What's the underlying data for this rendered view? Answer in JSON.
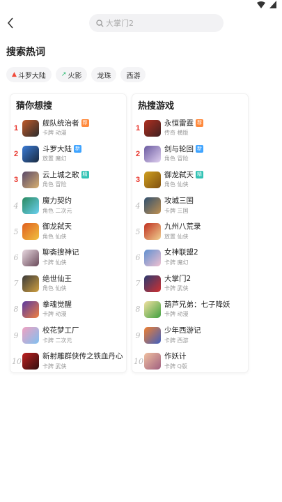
{
  "search": {
    "placeholder": "大掌门2"
  },
  "hot_words": {
    "title": "搜索热词",
    "tags": [
      {
        "label": "斗罗大陆",
        "icon": "fire-icon",
        "icon_color": "#f04a3a"
      },
      {
        "label": "火影",
        "icon": "trend-up-icon",
        "icon_color": "#1fb86a"
      },
      {
        "label": "龙珠",
        "icon": "",
        "icon_color": ""
      },
      {
        "label": "西游",
        "icon": "",
        "icon_color": ""
      }
    ]
  },
  "guess": {
    "title": "猜你想搜",
    "items": [
      {
        "rank": "1",
        "name": "舰队统治者",
        "sub": "卡牌 动漫",
        "badge": "荐",
        "badge_color": "#ff8a3d",
        "thumb": [
          "#c05a2a",
          "#2c2c2c"
        ]
      },
      {
        "rank": "2",
        "name": "斗罗大陆",
        "sub": "放置 魔幻",
        "badge": "新",
        "badge_color": "#3fa4ff",
        "thumb": [
          "#3a7bd5",
          "#1a2a40"
        ]
      },
      {
        "rank": "3",
        "name": "云上城之歌",
        "sub": "角色 冒险",
        "badge": "精",
        "badge_color": "#33c3b5",
        "thumb": [
          "#5a4a6a",
          "#d8b070"
        ]
      },
      {
        "rank": "4",
        "name": "魔力契约",
        "sub": "角色 二次元",
        "badge": "",
        "badge_color": "",
        "thumb": [
          "#2a8a60",
          "#6ad0f0"
        ]
      },
      {
        "rank": "5",
        "name": "御龙弑天",
        "sub": "角色 仙侠",
        "badge": "",
        "badge_color": "",
        "thumb": [
          "#e06020",
          "#f0c040"
        ]
      },
      {
        "rank": "6",
        "name": "聊斋搜神记",
        "sub": "卡牌 仙侠",
        "badge": "",
        "badge_color": "",
        "thumb": [
          "#e8d8e0",
          "#6a4a5a"
        ]
      },
      {
        "rank": "7",
        "name": "绝世仙王",
        "sub": "角色 仙侠",
        "badge": "",
        "badge_color": "",
        "thumb": [
          "#3a3a3a",
          "#d0a040"
        ]
      },
      {
        "rank": "8",
        "name": "拳魂觉醒",
        "sub": "卡牌 动漫",
        "badge": "",
        "badge_color": "",
        "thumb": [
          "#5a3aa0",
          "#f08040"
        ]
      },
      {
        "rank": "9",
        "name": "校花梦工厂",
        "sub": "卡牌 二次元",
        "badge": "",
        "badge_color": "",
        "thumb": [
          "#f0a0c0",
          "#80c0f0"
        ]
      },
      {
        "rank": "10",
        "name": "新射雕群侠传之铁血丹心",
        "sub": "卡牌 武侠",
        "badge": "",
        "badge_color": "",
        "thumb": [
          "#c02020",
          "#301010"
        ]
      }
    ]
  },
  "hot_games": {
    "title": "热搜游戏",
    "items": [
      {
        "rank": "1",
        "name": "永恒雷霆",
        "sub": "传奇 横版",
        "badge": "荐",
        "badge_color": "#ff8a3d",
        "thumb": [
          "#b03020",
          "#402020"
        ]
      },
      {
        "rank": "2",
        "name": "剑与轮回",
        "sub": "角色 冒险",
        "badge": "新",
        "badge_color": "#3fa4ff",
        "thumb": [
          "#6a5aa0",
          "#e0d0f0"
        ]
      },
      {
        "rank": "3",
        "name": "御龙弑天",
        "sub": "角色 仙侠",
        "badge": "精",
        "badge_color": "#33c3b5",
        "thumb": [
          "#d0a020",
          "#805010"
        ]
      },
      {
        "rank": "4",
        "name": "攻城三国",
        "sub": "卡牌 三国",
        "badge": "",
        "badge_color": "",
        "thumb": [
          "#305070",
          "#c09050"
        ]
      },
      {
        "rank": "5",
        "name": "九州八荒录",
        "sub": "放置 仙侠",
        "badge": "",
        "badge_color": "",
        "thumb": [
          "#c03020",
          "#f0d090"
        ]
      },
      {
        "rank": "6",
        "name": "女神联盟2",
        "sub": "卡牌 魔幻",
        "badge": "",
        "badge_color": "",
        "thumb": [
          "#6090d0",
          "#f0c0d0"
        ]
      },
      {
        "rank": "7",
        "name": "大掌门2",
        "sub": "卡牌 武侠",
        "badge": "",
        "badge_color": "",
        "thumb": [
          "#2a3a70",
          "#d03030"
        ]
      },
      {
        "rank": "8",
        "name": "葫芦兄弟：七子降妖",
        "sub": "卡牌 动漫",
        "badge": "",
        "badge_color": "",
        "thumb": [
          "#f0e0a0",
          "#40a040"
        ]
      },
      {
        "rank": "9",
        "name": "少年西游记",
        "sub": "卡牌 西游",
        "badge": "",
        "badge_color": "",
        "thumb": [
          "#f08030",
          "#4060c0"
        ]
      },
      {
        "rank": "10",
        "name": "作妖计",
        "sub": "卡牌 Q版",
        "badge": "",
        "badge_color": "",
        "thumb": [
          "#f0c0a0",
          "#a06080"
        ]
      }
    ]
  }
}
